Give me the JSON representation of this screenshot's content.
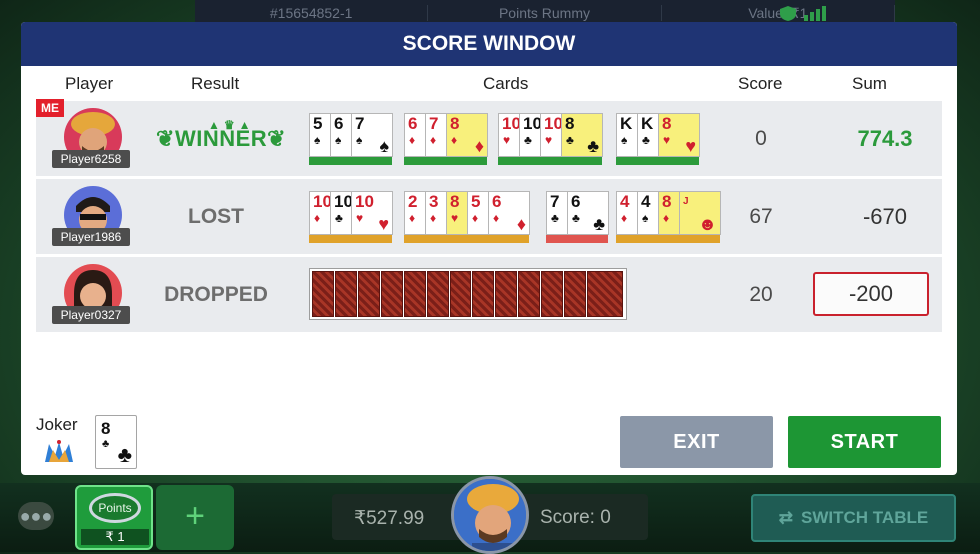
{
  "topbar": {
    "table_id": "#15654852-1",
    "game_type": "Points Rummy",
    "value": "Value: ₹1"
  },
  "modal": {
    "title": "SCORE WINDOW"
  },
  "headers": {
    "player": "Player",
    "result": "Result",
    "cards": "Cards",
    "score": "Score",
    "sum": "Sum"
  },
  "players": [
    {
      "name": "Player6258",
      "badge": "ME",
      "result": "WINNER",
      "score": "0",
      "sum": "774.3"
    },
    {
      "name": "Player1986",
      "result": "LOST",
      "score": "67",
      "sum": "-670"
    },
    {
      "name": "Player0327",
      "result": "DROPPED",
      "score": "20",
      "sum": "-200"
    }
  ],
  "joker": {
    "label": "Joker",
    "rank": "8",
    "suit": "♣"
  },
  "buttons": {
    "exit": "EXIT",
    "start": "START"
  },
  "bottom": {
    "points_label": "Points",
    "points_amount": "₹ 1",
    "add": "+",
    "wallet": "₹527.99",
    "score": "Score: 0",
    "switch_table": "SWITCH TABLE"
  },
  "colors": {
    "header_bg": "#1f3474",
    "winner_green": "#2b9a3b",
    "start_green": "#1d9634",
    "exit_gray": "#8b97a8",
    "highlight_red": "#c9212d"
  }
}
